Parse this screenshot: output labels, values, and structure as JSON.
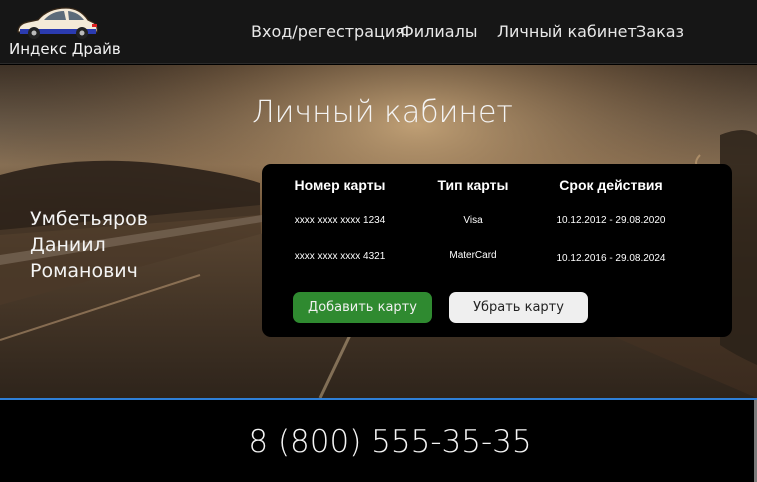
{
  "brand": {
    "name": "Индекс Драйв",
    "logo_icon": "car-logo-icon"
  },
  "nav": {
    "items": [
      {
        "label": "Вход/регестрация"
      },
      {
        "label": "Филиалы"
      },
      {
        "label": "Личный кабинет"
      },
      {
        "label": "Заказ"
      }
    ]
  },
  "hero": {
    "title": "Личный кабинет",
    "user": {
      "last_name": "Умбетьяров",
      "first_name": "Даниил",
      "patronymic": "Романович"
    }
  },
  "cards": {
    "headers": {
      "number": "Номер карты",
      "type": "Тип карты",
      "validity": "Срок действия"
    },
    "rows": [
      {
        "number": "xxxx xxxx xxxx 1234",
        "type": "Visa",
        "validity": "10.12.2012 - 29.08.2020"
      },
      {
        "number": "xxxx xxxx xxxx 4321",
        "type": "MaterCard",
        "validity": "10.12.2016 - 29.08.2024"
      }
    ],
    "add_button": "Добавить карту",
    "remove_button": "Убрать карту"
  },
  "footer": {
    "phone": "8 (800) 555-35-35"
  },
  "colors": {
    "header_bg": "#161616",
    "add_button": "#2f8a30",
    "remove_button": "#efefef",
    "divider": "#2e7fd8"
  }
}
